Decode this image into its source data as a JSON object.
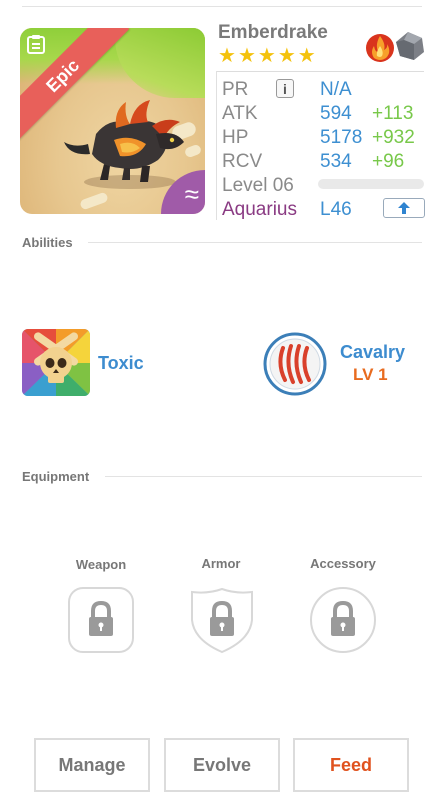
{
  "monster": {
    "name": "Emberdrake",
    "rarity_badge": "Epic",
    "element_symbol": "≈",
    "star_count": 5,
    "stars": [
      "★",
      "★",
      "★",
      "★",
      "★"
    ],
    "element_icons": [
      "fire-icon",
      "rock-icon"
    ]
  },
  "stats": {
    "pr": {
      "label": "PR",
      "value": "N/A"
    },
    "atk": {
      "label": "ATK",
      "value": "594",
      "bonus": "+113"
    },
    "hp": {
      "label": "HP",
      "value": "5178",
      "bonus": "+932"
    },
    "rcv": {
      "label": "RCV",
      "value": "534",
      "bonus": "+96"
    },
    "level": {
      "label": "Level 06",
      "progress": 0
    },
    "sign": {
      "label": "Aquarius",
      "value": "L46"
    },
    "info_button": "i"
  },
  "abilities": {
    "header": "Abilities",
    "items": [
      {
        "name": "Toxic",
        "icon": "skull-icon"
      },
      {
        "name": "Cavalry",
        "level": "LV 1",
        "icon": "claw-marks-icon"
      }
    ]
  },
  "equipment": {
    "header": "Equipment",
    "slots": [
      {
        "label": "Weapon",
        "icon": "lock-icon"
      },
      {
        "label": "Armor",
        "icon": "lock-icon"
      },
      {
        "label": "Accessory",
        "icon": "lock-icon"
      }
    ]
  },
  "actions": {
    "manage": "Manage",
    "evolve": "Evolve",
    "feed": "Feed"
  },
  "colors": {
    "stat_value": "#3d8fd1",
    "stat_bonus": "#78c84a",
    "sign": "#8a3b83",
    "epic_ribbon": "#e8605a",
    "feed": "#e0521e",
    "cavalry_level": "#e86b1f"
  }
}
